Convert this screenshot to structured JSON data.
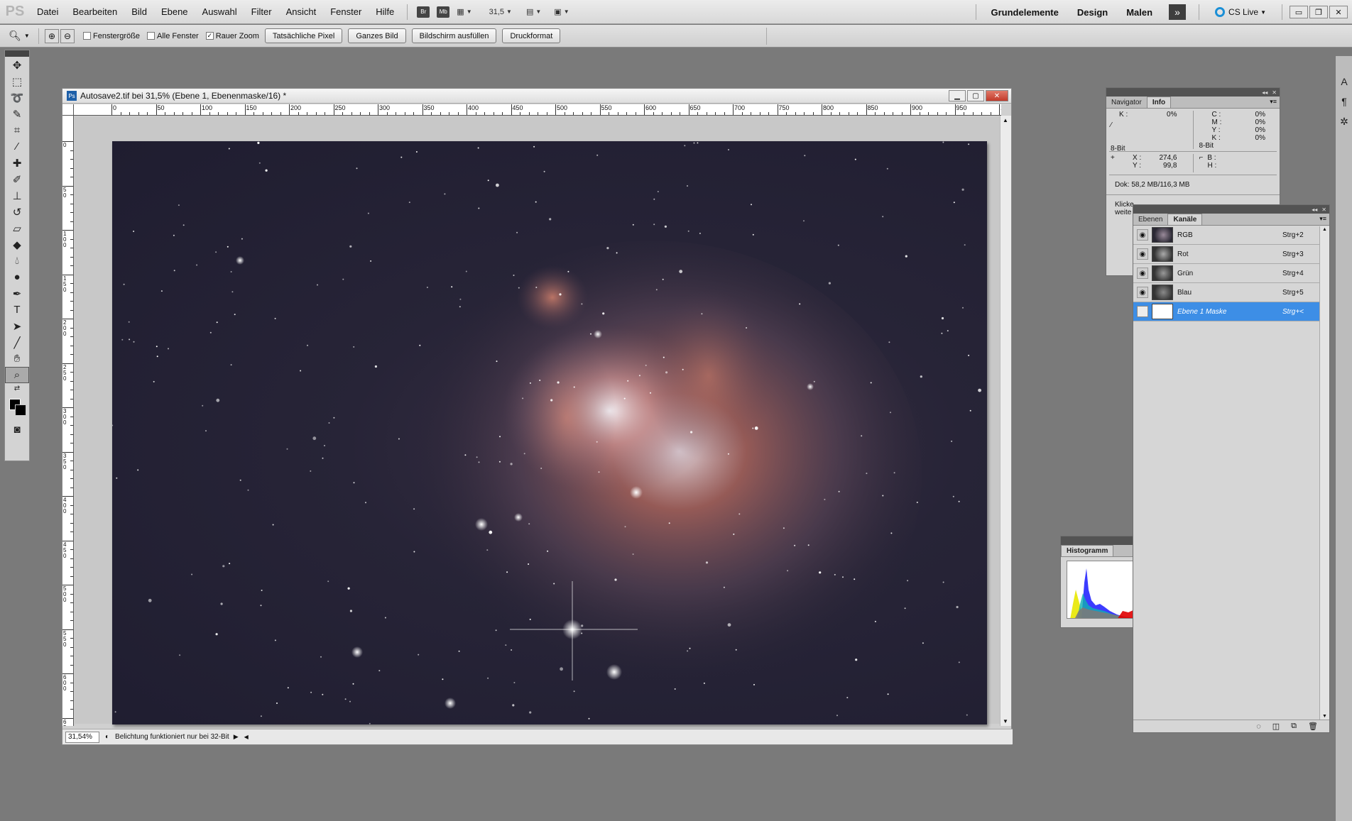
{
  "menubar": {
    "logo": "PS",
    "items": [
      "Datei",
      "Bearbeiten",
      "Bild",
      "Ebene",
      "Auswahl",
      "Filter",
      "Ansicht",
      "Fenster",
      "Hilfe"
    ],
    "bridge": "Br",
    "minibridge": "Mb",
    "zoom_value": "31,5",
    "workspaces": [
      "Grundelemente",
      "Design",
      "Malen"
    ],
    "cs_live": "CS Live"
  },
  "options": {
    "checkboxes": [
      {
        "label": "Fenstergröße",
        "checked": false
      },
      {
        "label": "Alle Fenster",
        "checked": false
      },
      {
        "label": "Rauer Zoom",
        "checked": true
      }
    ],
    "buttons": [
      "Tatsächliche Pixel",
      "Ganzes Bild",
      "Bildschirm ausfüllen",
      "Druckformat"
    ]
  },
  "document": {
    "title": "Autosave2.tif bei 31,5% (Ebene 1, Ebenenmaske/16) *",
    "zoom": "31,54%",
    "status_message": "Belichtung funktioniert nur bei 32-Bit",
    "ruler_h": [
      "0",
      "50",
      "100",
      "150",
      "200",
      "250",
      "300",
      "350",
      "400",
      "450",
      "500",
      "550",
      "600",
      "650",
      "700",
      "750",
      "800",
      "850",
      "900",
      "950",
      "1000"
    ],
    "ruler_v": [
      "0",
      "5 0",
      "1 0 0",
      "1 5 0",
      "2 0 0",
      "2 5 0",
      "3 0 0",
      "3 5 0",
      "4 0 0",
      "4 5 0",
      "5 0 0",
      "5 5 0",
      "6 0 0",
      "6 5 0"
    ]
  },
  "info_panel": {
    "tabs": [
      "Navigator",
      "Info"
    ],
    "k_label": "K :",
    "k_value": "0%",
    "bit_left": "8-Bit",
    "cmyk": [
      {
        "label": "C :",
        "value": "0%"
      },
      {
        "label": "M :",
        "value": "0%"
      },
      {
        "label": "Y :",
        "value": "0%"
      },
      {
        "label": "K :",
        "value": "0%"
      }
    ],
    "bit_right": "8-Bit",
    "x_label": "X :",
    "x_value": "274,6",
    "y_label": "Y :",
    "y_value": "99,8",
    "b_label": "B :",
    "h_label": "H :",
    "doc": "Dok: 58,2 MB/116,3 MB",
    "hint": "Klicke\nweite"
  },
  "channels_panel": {
    "tabs": [
      "Ebenen",
      "Kanäle"
    ],
    "rows": [
      {
        "name": "RGB",
        "key": "Strg+2",
        "visible": true,
        "selected": false
      },
      {
        "name": "Rot",
        "key": "Strg+3",
        "visible": true,
        "selected": false
      },
      {
        "name": "Grün",
        "key": "Strg+4",
        "visible": true,
        "selected": false
      },
      {
        "name": "Blau",
        "key": "Strg+5",
        "visible": true,
        "selected": false
      },
      {
        "name": "Ebene 1 Maske",
        "key": "Strg+<",
        "visible": false,
        "selected": true
      }
    ]
  },
  "histogram_panel": {
    "tab": "Histogramm"
  },
  "colors": {
    "selection": "#3d8ee6",
    "close_button": "#c23a2a"
  }
}
